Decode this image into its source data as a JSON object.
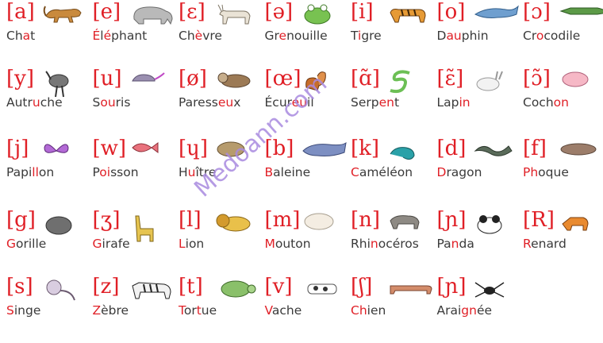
{
  "watermark": "Medoann.com",
  "colors": {
    "ipa": "#e01f26",
    "word": "#3a3a3a",
    "watermark": "#a98ae0"
  },
  "cards": [
    {
      "ipa": "[a]",
      "parts": [
        "Ch",
        "a",
        "t"
      ],
      "icon": "cat-icon"
    },
    {
      "ipa": "[e]",
      "parts": [
        "",
        "É",
        "l",
        "é",
        "phant"
      ],
      "icon": "elephant-icon"
    },
    {
      "ipa": "[ɛ]",
      "parts": [
        "Ch",
        "è",
        "vre"
      ],
      "icon": "goat-icon"
    },
    {
      "ipa": "[ə]",
      "parts": [
        "Gr",
        "e",
        "nouille"
      ],
      "icon": "frog-icon"
    },
    {
      "ipa": "[i]",
      "parts": [
        "T",
        "i",
        "gre"
      ],
      "icon": "tiger-icon"
    },
    {
      "ipa": "[o]",
      "parts": [
        "D",
        "au",
        "phin"
      ],
      "icon": "dolphin-icon"
    },
    {
      "ipa": "[ɔ]",
      "parts": [
        "Cr",
        "o",
        "codile"
      ],
      "icon": "crocodile-icon"
    },
    {
      "ipa": "[y]",
      "parts": [
        "Autr",
        "u",
        "che"
      ],
      "icon": "ostrich-icon"
    },
    {
      "ipa": "[u]",
      "parts": [
        "S",
        "ou",
        "ris"
      ],
      "icon": "mouse-icon"
    },
    {
      "ipa": "[ø]",
      "parts": [
        "Paress",
        "eu",
        "x"
      ],
      "icon": "sloth-icon"
    },
    {
      "ipa": "[œ]",
      "parts": [
        "Écur",
        "eu",
        "il"
      ],
      "icon": "squirrel-icon"
    },
    {
      "ipa": "[ɑ̃]",
      "parts": [
        "Serp",
        "en",
        "t"
      ],
      "icon": "snake-icon"
    },
    {
      "ipa": "[ɛ̃]",
      "parts": [
        "Lap",
        "in",
        ""
      ],
      "icon": "rabbit-icon"
    },
    {
      "ipa": "[ɔ̃]",
      "parts": [
        "Coch",
        "on",
        ""
      ],
      "icon": "pig-icon"
    },
    {
      "ipa": "[j]",
      "parts": [
        "Papi",
        "ll",
        "on"
      ],
      "icon": "butterfly-icon"
    },
    {
      "ipa": "[w]",
      "parts": [
        "P",
        "oi",
        "sson"
      ],
      "icon": "fish-icon"
    },
    {
      "ipa": "[ɥ]",
      "parts": [
        "H",
        "u",
        "ître"
      ],
      "icon": "oyster-icon"
    },
    {
      "ipa": "[b]",
      "parts": [
        "",
        "B",
        "aleine"
      ],
      "icon": "whale-icon"
    },
    {
      "ipa": "[k]",
      "parts": [
        "",
        "C",
        "améléon"
      ],
      "icon": "chameleon-icon"
    },
    {
      "ipa": "[d]",
      "parts": [
        "",
        "D",
        "ragon"
      ],
      "icon": "dragon-icon"
    },
    {
      "ipa": "[f]",
      "parts": [
        "",
        "Ph",
        "oque"
      ],
      "icon": "seal-icon"
    },
    {
      "ipa": "[g]",
      "parts": [
        "",
        "G",
        "orille"
      ],
      "icon": "gorilla-icon"
    },
    {
      "ipa": "[ʒ]",
      "parts": [
        "",
        "G",
        "irafe"
      ],
      "icon": "giraffe-icon"
    },
    {
      "ipa": "[l]",
      "parts": [
        "",
        "L",
        "ion"
      ],
      "icon": "lion-icon"
    },
    {
      "ipa": "[m]",
      "parts": [
        "",
        "M",
        "outon"
      ],
      "icon": "sheep-icon"
    },
    {
      "ipa": "[n]",
      "parts": [
        "Rhi",
        "n",
        "océros"
      ],
      "icon": "rhinoceros-icon"
    },
    {
      "ipa": "[ɲ]",
      "parts": [
        "Pa",
        "n",
        "da"
      ],
      "icon": "panda-icon"
    },
    {
      "ipa": "[R]",
      "parts": [
        "",
        "R",
        "enard"
      ],
      "icon": "fox-icon"
    },
    {
      "ipa": "[s]",
      "parts": [
        "",
        "S",
        "inge"
      ],
      "icon": "monkey-icon"
    },
    {
      "ipa": "[z]",
      "parts": [
        "",
        "Z",
        "èbre"
      ],
      "icon": "zebra-icon"
    },
    {
      "ipa": "[t]",
      "parts": [
        "",
        "T",
        "or",
        "t",
        "ue"
      ],
      "icon": "turtle-icon"
    },
    {
      "ipa": "[v]",
      "parts": [
        "",
        "V",
        "ache"
      ],
      "icon": "cow-icon"
    },
    {
      "ipa": "[ʃ]",
      "parts": [
        "",
        "Ch",
        "ien"
      ],
      "icon": "dog-icon"
    },
    {
      "ipa": "[ɲ]",
      "parts": [
        "Arai",
        "gn",
        "ée"
      ],
      "icon": "spider-icon"
    }
  ]
}
